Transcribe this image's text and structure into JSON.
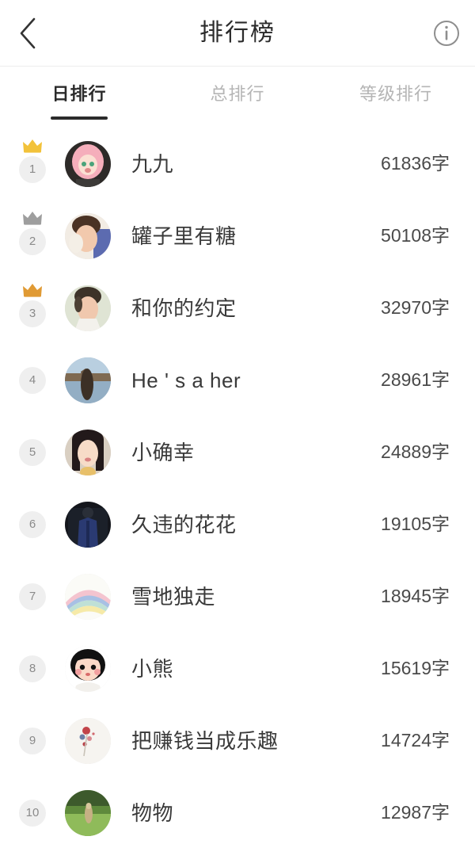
{
  "header": {
    "title": "排行榜",
    "back_icon": "chevron-left-icon",
    "info_icon": "info-circle-icon"
  },
  "tabs": [
    {
      "label": "日排行",
      "active": true
    },
    {
      "label": "总排行",
      "active": false
    },
    {
      "label": "等级排行",
      "active": false
    }
  ],
  "colors": {
    "crown_gold": "#f2c23a",
    "crown_silver": "#9e9e9e",
    "crown_bronze": "#e09a34",
    "badge_bg": "#efefef",
    "badge_text": "#8a8a8a",
    "active_text": "#2b2b2b",
    "inactive_text": "#b5b5b5",
    "underline": "#2b2b2b"
  },
  "ranking": [
    {
      "rank": "1",
      "name": "九九",
      "count": "61836字",
      "crown": "gold",
      "avatar": "anime-pink-hair-avatar"
    },
    {
      "rank": "2",
      "name": "罐子里有糖",
      "count": "50108字",
      "crown": "silver",
      "avatar": "brown-hair-person-avatar"
    },
    {
      "rank": "3",
      "name": "和你的约定",
      "count": "32970字",
      "crown": "bronze",
      "avatar": "short-hair-person-avatar"
    },
    {
      "rank": "4",
      "name": "He ' s a her",
      "count": "28961字",
      "crown": "none",
      "avatar": "lakeside-scenery-avatar"
    },
    {
      "rank": "5",
      "name": "小确幸",
      "count": "24889字",
      "crown": "none",
      "avatar": "long-hair-woman-avatar"
    },
    {
      "rank": "6",
      "name": "久违的花花",
      "count": "19105字",
      "crown": "none",
      "avatar": "dark-navy-figure-avatar"
    },
    {
      "rank": "7",
      "name": "雪地独走",
      "count": "18945字",
      "crown": "none",
      "avatar": "pastel-rainbow-avatar"
    },
    {
      "rank": "8",
      "name": "小熊",
      "count": "15619字",
      "crown": "none",
      "avatar": "cartoon-girl-avatar"
    },
    {
      "rank": "9",
      "name": "把赚钱当成乐趣",
      "count": "14724字",
      "crown": "none",
      "avatar": "white-flowers-avatar"
    },
    {
      "rank": "10",
      "name": "物物",
      "count": "12987字",
      "crown": "none",
      "avatar": "green-field-avatar"
    }
  ]
}
